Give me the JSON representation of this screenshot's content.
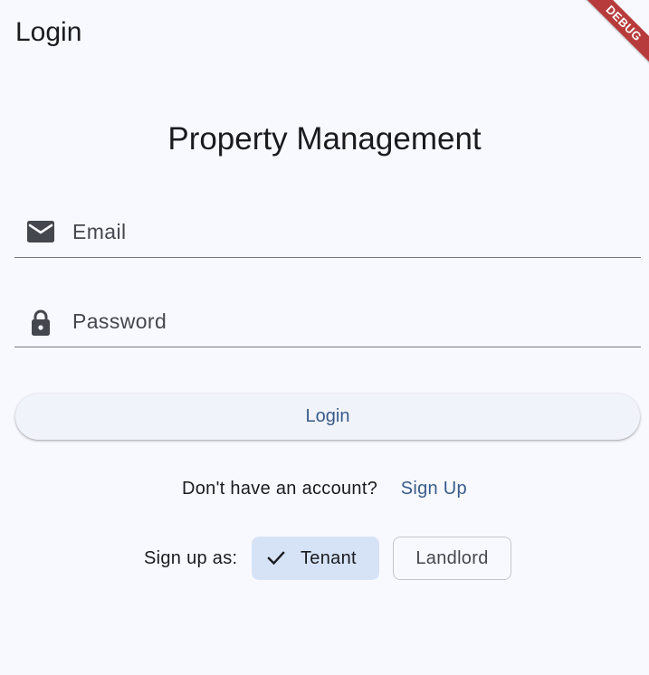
{
  "appbar": {
    "title": "Login",
    "debug_label": "DEBUG"
  },
  "main": {
    "heading": "Property Management",
    "email": {
      "placeholder": "Email",
      "value": "",
      "icon": "mail-icon"
    },
    "password": {
      "placeholder": "Password",
      "value": "",
      "icon": "lock-icon"
    },
    "login_button": "Login",
    "signup": {
      "prompt": "Don't have an account?",
      "link": "Sign Up"
    },
    "role": {
      "label": "Sign up as:",
      "options": [
        {
          "label": "Tenant",
          "selected": true,
          "icon": "check-icon"
        },
        {
          "label": "Landlord",
          "selected": false
        }
      ]
    }
  },
  "colors": {
    "background": "#f8f9ff",
    "primary": "#385b8b",
    "selected_chip": "#d6e3f7",
    "debug_banner": "#b83b3b"
  }
}
